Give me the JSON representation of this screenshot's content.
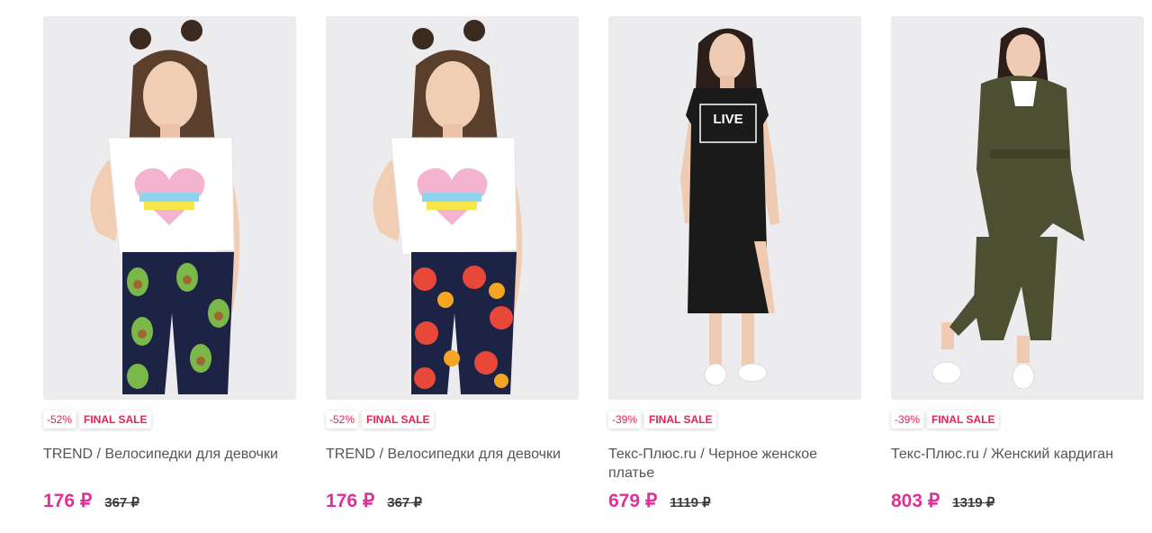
{
  "products": [
    {
      "discount": "-52%",
      "sale_badge": "FINAL SALE",
      "title": "TREND / Велосипедки для девочки",
      "price": "176 ₽",
      "old_price": "367 ₽",
      "image": "girl-avocado-shorts-photo"
    },
    {
      "discount": "-52%",
      "sale_badge": "FINAL SALE",
      "title": "TREND / Велосипедки для девочки",
      "price": "176 ₽",
      "old_price": "367 ₽",
      "image": "girl-peach-shorts-photo"
    },
    {
      "discount": "-39%",
      "sale_badge": "FINAL SALE",
      "title": "Текс-Плюс.ru / Черное женское платье",
      "price": "679 ₽",
      "old_price": "1119 ₽",
      "image": "woman-black-dress-photo",
      "print_text": "LIVE"
    },
    {
      "discount": "-39%",
      "sale_badge": "FINAL SALE",
      "title": "Текс-Плюс.ru / Женский кардиган",
      "price": "803 ₽",
      "old_price": "1319 ₽",
      "image": "woman-khaki-cardigan-photo"
    }
  ],
  "colors": {
    "price": "#e0309a",
    "badge_text": "#e8224f",
    "title_text": "#555555",
    "image_bg": "#ececee"
  }
}
